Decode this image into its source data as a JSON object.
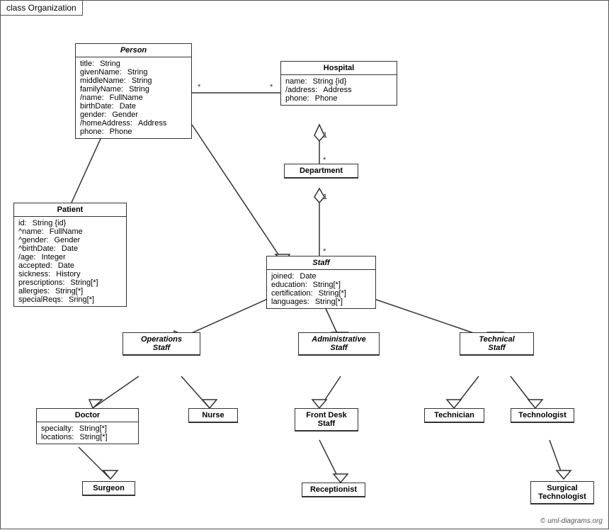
{
  "diagram": {
    "title": "class Organization",
    "copyright": "© uml-diagrams.org",
    "classes": {
      "person": {
        "name": "Person",
        "italic": true,
        "attrs": [
          {
            "name": "title:",
            "type": "String"
          },
          {
            "name": "givenName:",
            "type": "String"
          },
          {
            "name": "middleName:",
            "type": "String"
          },
          {
            "name": "familyName:",
            "type": "String"
          },
          {
            "name": "/name:",
            "type": "FullName"
          },
          {
            "name": "birthDate:",
            "type": "Date"
          },
          {
            "name": "gender:",
            "type": "Gender"
          },
          {
            "name": "/homeAddress:",
            "type": "Address"
          },
          {
            "name": "phone:",
            "type": "Phone"
          }
        ]
      },
      "hospital": {
        "name": "Hospital",
        "italic": false,
        "attrs": [
          {
            "name": "name:",
            "type": "String {id}"
          },
          {
            "name": "/address:",
            "type": "Address"
          },
          {
            "name": "phone:",
            "type": "Phone"
          }
        ]
      },
      "patient": {
        "name": "Patient",
        "italic": false,
        "attrs": [
          {
            "name": "id:",
            "type": "String {id}"
          },
          {
            "name": "^name:",
            "type": "FullName"
          },
          {
            "name": "^gender:",
            "type": "Gender"
          },
          {
            "name": "^birthDate:",
            "type": "Date"
          },
          {
            "name": "/age:",
            "type": "Integer"
          },
          {
            "name": "accepted:",
            "type": "Date"
          },
          {
            "name": "sickness:",
            "type": "History"
          },
          {
            "name": "prescriptions:",
            "type": "String[*]"
          },
          {
            "name": "allergies:",
            "type": "String[*]"
          },
          {
            "name": "specialReqs:",
            "type": "Sring[*]"
          }
        ]
      },
      "department": {
        "name": "Department",
        "italic": false,
        "attrs": []
      },
      "staff": {
        "name": "Staff",
        "italic": true,
        "attrs": [
          {
            "name": "joined:",
            "type": "Date"
          },
          {
            "name": "education:",
            "type": "String[*]"
          },
          {
            "name": "certification:",
            "type": "String[*]"
          },
          {
            "name": "languages:",
            "type": "String[*]"
          }
        ]
      },
      "operations_staff": {
        "name": "Operations\nStaff",
        "italic": true,
        "attrs": []
      },
      "administrative_staff": {
        "name": "Administrative\nStaff",
        "italic": true,
        "attrs": []
      },
      "technical_staff": {
        "name": "Technical\nStaff",
        "italic": true,
        "attrs": []
      },
      "doctor": {
        "name": "Doctor",
        "italic": false,
        "attrs": [
          {
            "name": "specialty:",
            "type": "String[*]"
          },
          {
            "name": "locations:",
            "type": "String[*]"
          }
        ]
      },
      "nurse": {
        "name": "Nurse",
        "italic": false,
        "attrs": []
      },
      "front_desk_staff": {
        "name": "Front Desk\nStaff",
        "italic": false,
        "attrs": []
      },
      "technician": {
        "name": "Technician",
        "italic": false,
        "attrs": []
      },
      "technologist": {
        "name": "Technologist",
        "italic": false,
        "attrs": []
      },
      "surgeon": {
        "name": "Surgeon",
        "italic": false,
        "attrs": []
      },
      "receptionist": {
        "name": "Receptionist",
        "italic": false,
        "attrs": []
      },
      "surgical_technologist": {
        "name": "Surgical\nTechnologist",
        "italic": false,
        "attrs": []
      }
    }
  }
}
